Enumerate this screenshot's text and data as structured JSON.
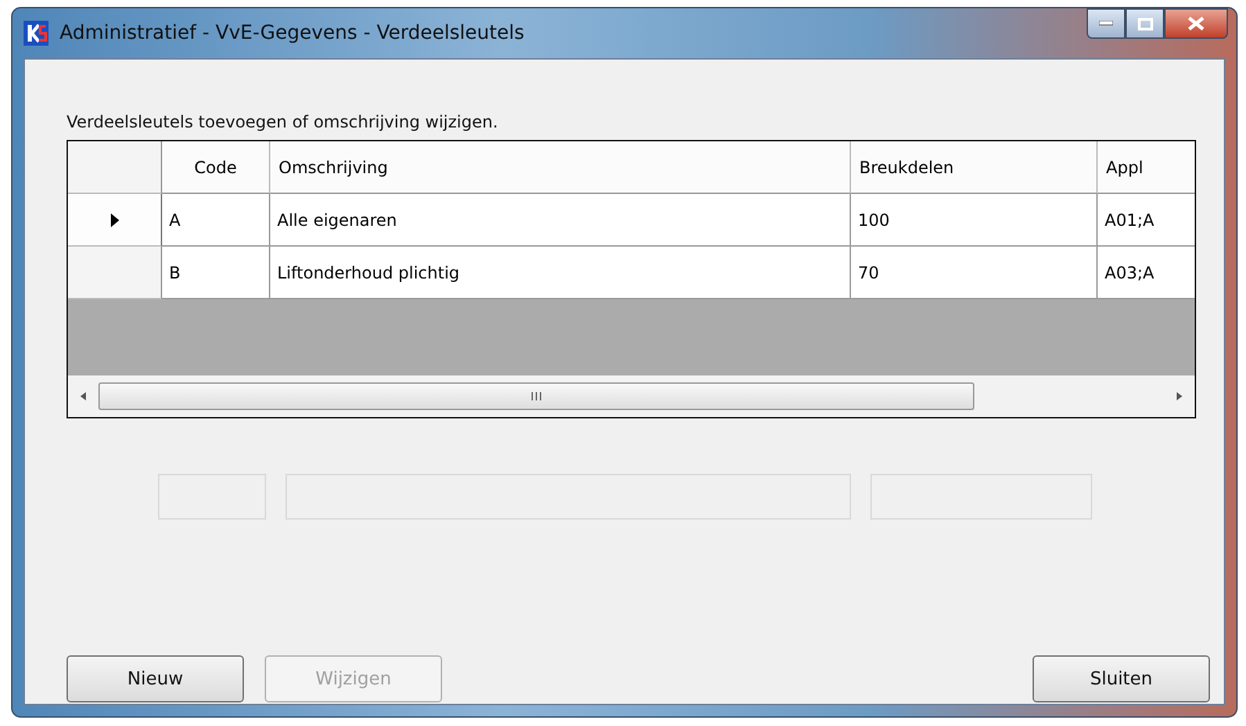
{
  "window": {
    "title": "Administratief - VvE-Gegevens - Verdeelsleutels"
  },
  "instruction": "Verdeelsleutels toevoegen of omschrijving wijzigen.",
  "table": {
    "columns": [
      "Code",
      "Omschrijving",
      "Breukdelen",
      "Appl"
    ],
    "rows": [
      {
        "selected": true,
        "cells": [
          "A",
          "Alle eigenaren",
          "100",
          "A01;A"
        ]
      },
      {
        "selected": false,
        "cells": [
          "B",
          "Liftonderhoud plichtig",
          "70",
          "A03;A"
        ]
      }
    ]
  },
  "edit_fields": [
    {
      "disabled": true
    },
    {
      "disabled": true
    },
    {
      "disabled": true
    }
  ],
  "buttons": [
    {
      "label": "Nieuw",
      "disabled": false
    },
    {
      "label": "Wijzigen",
      "disabled": true
    },
    {
      "label": "Sluiten",
      "disabled": false
    }
  ]
}
